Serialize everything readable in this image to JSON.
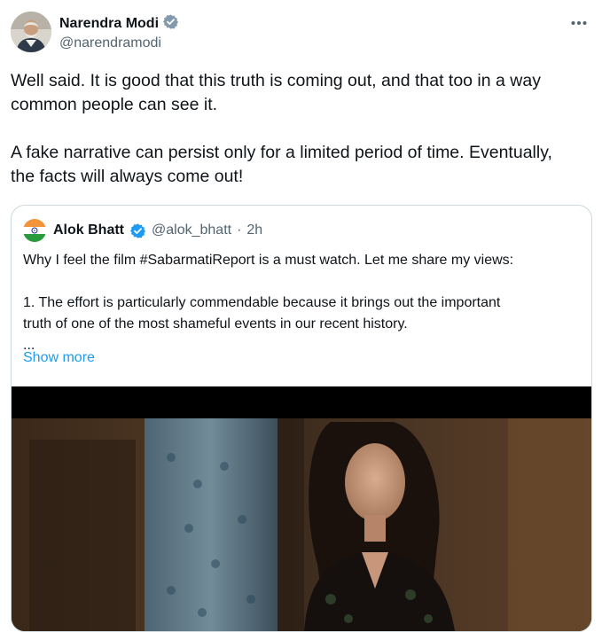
{
  "author": {
    "name": "Narendra Modi",
    "handle": "@narendramodi",
    "verified_badge": "gray-verified-badge-icon"
  },
  "tweet": {
    "text": "Well said. It is good that this truth is coming out, and that too in a way\ncommon people can see it.\n\nA fake narrative can persist only for a limited period of time. Eventually,\nthe facts will always come out!"
  },
  "menu_icon": "more-horizontal-icon",
  "quoted_tweet": {
    "name": "Alok Bhatt",
    "handle": "@alok_bhatt",
    "separator": "·",
    "time": "2h",
    "text": "Why I feel the film #SabarmatiReport is a must watch. Let me share my views:\n\n1. The effort is particularly commendable because it brings out the important\ntruth of one of the most shameful events in our recent history.\n...",
    "show_more": "Show more",
    "avatar_icon": "india-flag-icon",
    "verified_badge": "blue-verified-badge-icon"
  },
  "colors": {
    "accent": "#1d9bf0",
    "secondary_text": "#536471",
    "border": "#cfd9de",
    "gray_badge": "#829aab"
  }
}
